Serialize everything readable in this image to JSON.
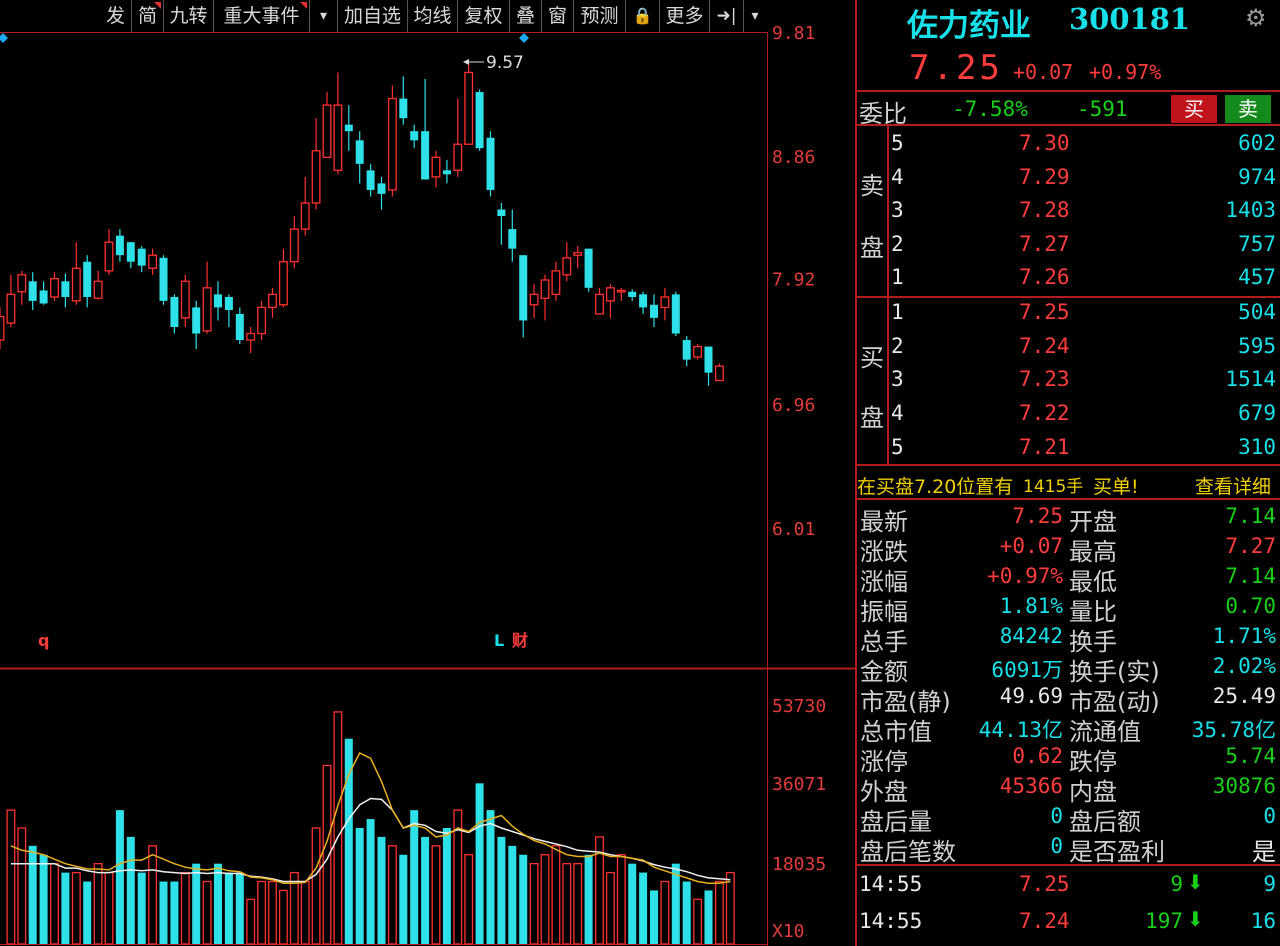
{
  "toolbar": {
    "items": [
      "发",
      "简",
      "九转",
      "重大事件",
      "▾",
      "加自选",
      "均线",
      "复权",
      "叠",
      "窗",
      "预测",
      "🔒",
      "更多",
      "➜|",
      "▾"
    ]
  },
  "stock": {
    "name": "佐力药业",
    "code": "300181",
    "price": "7.25",
    "change": "+0.07",
    "change_pct": "+0.97%"
  },
  "weibi": {
    "label": "委比",
    "pct": "-7.58%",
    "diff": "-591",
    "buy_label": "买",
    "sell_label": "卖"
  },
  "orderbook": {
    "sell_label_1": "卖",
    "sell_label_2": "盘",
    "buy_label_1": "买",
    "buy_label_2": "盘",
    "asks": [
      {
        "level": "5",
        "price": "7.30",
        "volume": "602"
      },
      {
        "level": "4",
        "price": "7.29",
        "volume": "974"
      },
      {
        "level": "3",
        "price": "7.28",
        "volume": "1403"
      },
      {
        "level": "2",
        "price": "7.27",
        "volume": "757"
      },
      {
        "level": "1",
        "price": "7.26",
        "volume": "457"
      }
    ],
    "bids": [
      {
        "level": "1",
        "price": "7.25",
        "volume": "504"
      },
      {
        "level": "2",
        "price": "7.24",
        "volume": "595"
      },
      {
        "level": "3",
        "price": "7.23",
        "volume": "1514"
      },
      {
        "level": "4",
        "price": "7.22",
        "volume": "679"
      },
      {
        "level": "5",
        "price": "7.21",
        "volume": "310"
      }
    ]
  },
  "notice": {
    "text1": "在买盘7.20位置有",
    "qty": "1415手",
    "text2": "买单!",
    "detail_link": "查看详细"
  },
  "stats": [
    {
      "l1": "最新",
      "v1": "7.25",
      "c1": "red",
      "l2": "开盘",
      "v2": "7.14",
      "c2": "green"
    },
    {
      "l1": "涨跌",
      "v1": "+0.07",
      "c1": "red",
      "l2": "最高",
      "v2": "7.27",
      "c2": "red"
    },
    {
      "l1": "涨幅",
      "v1": "+0.97%",
      "c1": "red",
      "l2": "最低",
      "v2": "7.14",
      "c2": "green"
    },
    {
      "l1": "振幅",
      "v1": "1.81%",
      "c1": "cyan",
      "l2": "量比",
      "v2": "0.70",
      "c2": "green"
    },
    {
      "l1": "总手",
      "v1": "84242",
      "c1": "cyan",
      "l2": "换手",
      "v2": "1.71%",
      "c2": "cyan"
    },
    {
      "l1": "金额",
      "v1": "6091万",
      "c1": "cyan",
      "l2": "换手(实)",
      "v2": "2.02%",
      "c2": "cyan"
    },
    {
      "l1": "市盈(静)",
      "v1": "49.69",
      "c1": "white",
      "l2": "市盈(动)",
      "v2": "25.49",
      "c2": "white"
    },
    {
      "l1": "总市值",
      "v1": "44.13亿",
      "c1": "cyan",
      "l2": "流通值",
      "v2": "35.78亿",
      "c2": "cyan"
    },
    {
      "l1": "涨停",
      "v1": "0.62",
      "c1": "red",
      "l2": "跌停",
      "v2": "5.74",
      "c2": "green"
    },
    {
      "l1": "外盘",
      "v1": "45366",
      "c1": "red",
      "l2": "内盘",
      "v2": "30876",
      "c2": "green"
    },
    {
      "l1": "盘后量",
      "v1": "0",
      "c1": "cyan",
      "l2": "盘后额",
      "v2": "0",
      "c2": "cyan"
    },
    {
      "l1": "盘后笔数",
      "v1": "0",
      "c1": "cyan",
      "l2": "是否盈利",
      "v2": "是",
      "c2": "white"
    }
  ],
  "ticks": [
    {
      "time": "14:55",
      "price": "7.25",
      "vol": "9",
      "count": "9"
    },
    {
      "time": "14:55",
      "price": "7.24",
      "vol": "197",
      "count": "16"
    }
  ],
  "chart_data": {
    "type": "candlestick",
    "price_axis_labels": [
      "9.81",
      "8.86",
      "7.92",
      "6.96",
      "6.01"
    ],
    "price_axis_values": [
      9.81,
      8.86,
      7.92,
      6.96,
      6.01
    ],
    "high_annotation": "9.57",
    "markers": [
      "q",
      "L",
      "财"
    ],
    "volume_axis_labels": [
      "53730",
      "36071",
      "18035",
      "X10"
    ],
    "volume_axis_values": [
      53730,
      36071,
      18035
    ],
    "candles": [
      {
        "o": 7.45,
        "c": 7.63,
        "h": 7.7,
        "l": 7.38,
        "up": true
      },
      {
        "o": 7.58,
        "c": 7.8,
        "h": 7.95,
        "l": 7.55,
        "up": true
      },
      {
        "o": 7.82,
        "c": 7.95,
        "h": 7.98,
        "l": 7.72,
        "up": true
      },
      {
        "o": 7.9,
        "c": 7.75,
        "h": 7.97,
        "l": 7.68,
        "up": false
      },
      {
        "o": 7.83,
        "c": 7.73,
        "h": 7.9,
        "l": 7.72,
        "up": false
      },
      {
        "o": 7.78,
        "c": 7.92,
        "h": 7.97,
        "l": 7.75,
        "up": true
      },
      {
        "o": 7.9,
        "c": 7.78,
        "h": 7.96,
        "l": 7.7,
        "up": false
      },
      {
        "o": 7.75,
        "c": 8.0,
        "h": 8.2,
        "l": 7.72,
        "up": true
      },
      {
        "o": 8.05,
        "c": 7.78,
        "h": 8.1,
        "l": 7.7,
        "up": false
      },
      {
        "o": 7.77,
        "c": 7.9,
        "h": 7.98,
        "l": 7.76,
        "up": true
      },
      {
        "o": 7.98,
        "c": 8.2,
        "h": 8.3,
        "l": 7.95,
        "up": true
      },
      {
        "o": 8.25,
        "c": 8.1,
        "h": 8.3,
        "l": 8.05,
        "up": false
      },
      {
        "o": 8.2,
        "c": 8.05,
        "h": 8.2,
        "l": 8.0,
        "up": false
      },
      {
        "o": 8.15,
        "c": 8.02,
        "h": 8.17,
        "l": 7.97,
        "up": false
      },
      {
        "o": 8.0,
        "c": 8.1,
        "h": 8.15,
        "l": 7.95,
        "up": true
      },
      {
        "o": 8.08,
        "c": 7.75,
        "h": 8.1,
        "l": 7.72,
        "up": false
      },
      {
        "o": 7.78,
        "c": 7.55,
        "h": 7.8,
        "l": 7.5,
        "up": false
      },
      {
        "o": 7.62,
        "c": 7.9,
        "h": 7.95,
        "l": 7.55,
        "up": true
      },
      {
        "o": 7.7,
        "c": 7.5,
        "h": 7.75,
        "l": 7.38,
        "up": false
      },
      {
        "o": 7.52,
        "c": 7.85,
        "h": 8.05,
        "l": 7.5,
        "up": true
      },
      {
        "o": 7.8,
        "c": 7.7,
        "h": 7.9,
        "l": 7.6,
        "up": false
      },
      {
        "o": 7.78,
        "c": 7.68,
        "h": 7.8,
        "l": 7.55,
        "up": false
      },
      {
        "o": 7.65,
        "c": 7.45,
        "h": 7.7,
        "l": 7.42,
        "up": false
      },
      {
        "o": 7.45,
        "c": 7.5,
        "h": 7.55,
        "l": 7.35,
        "up": true
      },
      {
        "o": 7.5,
        "c": 7.7,
        "h": 7.75,
        "l": 7.45,
        "up": true
      },
      {
        "o": 7.7,
        "c": 7.8,
        "h": 7.85,
        "l": 7.62,
        "up": true
      },
      {
        "o": 7.72,
        "c": 8.05,
        "h": 8.15,
        "l": 7.7,
        "up": true
      },
      {
        "o": 8.05,
        "c": 8.3,
        "h": 8.4,
        "l": 8.0,
        "up": true
      },
      {
        "o": 8.3,
        "c": 8.5,
        "h": 8.7,
        "l": 8.25,
        "up": true
      },
      {
        "o": 8.5,
        "c": 8.9,
        "h": 9.15,
        "l": 8.45,
        "up": true
      },
      {
        "o": 8.85,
        "c": 9.25,
        "h": 9.35,
        "l": 8.85,
        "up": true
      },
      {
        "o": 9.25,
        "c": 8.75,
        "h": 9.5,
        "l": 8.72,
        "up": true
      },
      {
        "o": 9.1,
        "c": 9.05,
        "h": 9.25,
        "l": 8.9,
        "up": false
      },
      {
        "o": 8.98,
        "c": 8.8,
        "h": 9.05,
        "l": 8.65,
        "up": false
      },
      {
        "o": 8.75,
        "c": 8.6,
        "h": 8.8,
        "l": 8.55,
        "up": false
      },
      {
        "o": 8.65,
        "c": 8.57,
        "h": 8.7,
        "l": 8.45,
        "up": false
      },
      {
        "o": 8.6,
        "c": 9.3,
        "h": 9.4,
        "l": 8.55,
        "up": true
      },
      {
        "o": 9.3,
        "c": 9.15,
        "h": 9.47,
        "l": 9.1,
        "up": false
      },
      {
        "o": 9.05,
        "c": 8.98,
        "h": 9.1,
        "l": 8.92,
        "up": false
      },
      {
        "o": 9.05,
        "c": 8.68,
        "h": 9.45,
        "l": 8.68,
        "up": false
      },
      {
        "o": 8.7,
        "c": 8.85,
        "h": 8.9,
        "l": 8.62,
        "up": true
      },
      {
        "o": 8.75,
        "c": 8.72,
        "h": 8.83,
        "l": 8.65,
        "up": false
      },
      {
        "o": 8.75,
        "c": 8.95,
        "h": 9.3,
        "l": 8.7,
        "up": true
      },
      {
        "o": 8.95,
        "c": 9.5,
        "h": 9.57,
        "l": 8.95,
        "up": true
      },
      {
        "o": 9.35,
        "c": 8.92,
        "h": 9.37,
        "l": 8.9,
        "up": false
      },
      {
        "o": 9.0,
        "c": 8.6,
        "h": 9.05,
        "l": 8.55,
        "up": false
      },
      {
        "o": 8.45,
        "c": 8.4,
        "h": 8.5,
        "l": 8.18,
        "up": false
      },
      {
        "o": 8.3,
        "c": 8.15,
        "h": 8.45,
        "l": 8.05,
        "up": false
      },
      {
        "o": 8.1,
        "c": 7.6,
        "h": 8.1,
        "l": 7.47,
        "up": false
      },
      {
        "o": 7.72,
        "c": 7.8,
        "h": 7.88,
        "l": 7.62,
        "up": true
      },
      {
        "o": 7.77,
        "c": 7.91,
        "h": 7.95,
        "l": 7.6,
        "up": true
      },
      {
        "o": 7.8,
        "c": 7.98,
        "h": 8.05,
        "l": 7.75,
        "up": true
      },
      {
        "o": 7.95,
        "c": 8.08,
        "h": 8.2,
        "l": 7.9,
        "up": true
      },
      {
        "o": 8.1,
        "c": 8.12,
        "h": 8.17,
        "l": 8.0,
        "up": true
      },
      {
        "o": 8.15,
        "c": 7.85,
        "h": 8.15,
        "l": 7.82,
        "up": false
      },
      {
        "o": 7.65,
        "c": 7.8,
        "h": 7.85,
        "l": 7.65,
        "up": true
      },
      {
        "o": 7.75,
        "c": 7.85,
        "h": 7.88,
        "l": 7.62,
        "up": true
      },
      {
        "o": 7.83,
        "c": 7.82,
        "h": 7.85,
        "l": 7.75,
        "up": true
      },
      {
        "o": 7.82,
        "c": 7.78,
        "h": 7.84,
        "l": 7.75,
        "up": false
      },
      {
        "o": 7.8,
        "c": 7.7,
        "h": 7.82,
        "l": 7.65,
        "up": false
      },
      {
        "o": 7.72,
        "c": 7.62,
        "h": 7.8,
        "l": 7.55,
        "up": false
      },
      {
        "o": 7.7,
        "c": 7.78,
        "h": 7.85,
        "l": 7.6,
        "up": true
      },
      {
        "o": 7.8,
        "c": 7.5,
        "h": 7.82,
        "l": 7.48,
        "up": false
      },
      {
        "o": 7.45,
        "c": 7.3,
        "h": 7.48,
        "l": 7.25,
        "up": false
      },
      {
        "o": 7.32,
        "c": 7.4,
        "h": 7.42,
        "l": 7.3,
        "up": true
      },
      {
        "o": 7.4,
        "c": 7.2,
        "h": 7.4,
        "l": 7.1,
        "up": false
      },
      {
        "o": 7.14,
        "c": 7.25,
        "h": 7.27,
        "l": 7.14,
        "up": true
      }
    ],
    "volume": [
      15,
      13,
      11,
      10,
      9,
      8,
      8,
      7,
      9,
      8,
      15,
      12,
      8,
      11,
      7,
      7,
      8,
      9,
      7,
      9,
      8,
      8,
      5,
      7,
      7,
      6,
      8,
      7,
      13,
      20,
      26,
      23,
      13,
      14,
      12,
      11,
      10,
      15,
      12,
      11,
      13,
      15,
      10,
      18,
      15,
      12,
      11,
      10,
      9,
      10,
      11,
      9,
      9,
      10,
      12,
      8,
      10,
      9,
      8,
      6,
      7,
      9,
      7,
      5,
      6,
      7,
      8
    ],
    "ma_volume_1": [
      9,
      9,
      9,
      9,
      9,
      8.5,
      8.5,
      8.2,
      8,
      8,
      8.2,
      8.3,
      8.2,
      8.3,
      8.1,
      8,
      7.9,
      8,
      7.9,
      8,
      7.9,
      7.9,
      7.6,
      7.5,
      7.3,
      7,
      7,
      7,
      7.8,
      9.5,
      12,
      14,
      15.6,
      16.3,
      16.2,
      15,
      13,
      13.5,
      13.3,
      12.6,
      12.4,
      12.8,
      12.5,
      13.2,
      13.5,
      13,
      12.6,
      12.2,
      11.8,
      11.5,
      11.2,
      10.9,
      10.5,
      10.4,
      10.3,
      10,
      9.8,
      9.6,
      9.3,
      8.9,
      8.6,
      8.4,
      8.1,
      7.7,
      7.4,
      7.3,
      7.2
    ],
    "ma_volume_2": [
      11,
      10.5,
      10.3,
      10,
      9.5,
      9,
      8.7,
      8.4,
      8.4,
      8.3,
      9,
      9.4,
      9.4,
      10,
      9.5,
      9,
      8.6,
      8.4,
      8.3,
      8.5,
      8.2,
      8.1,
      7.5,
      7.4,
      7.2,
      6.8,
      6.8,
      6.9,
      8.5,
      11.5,
      15.5,
      19,
      21.4,
      20.8,
      18.2,
      15,
      13,
      13.3,
      13,
      12,
      12.2,
      13,
      12.6,
      13.6,
      14,
      14.4,
      13.2,
      12.3,
      11.6,
      11.2,
      10.6,
      10,
      9.8,
      9.8,
      10.2,
      9.8,
      9.8,
      9.6,
      9.4,
      8.6,
      8.2,
      7.8,
      7.4,
      7,
      6.8,
      6.8,
      7.0
    ]
  }
}
